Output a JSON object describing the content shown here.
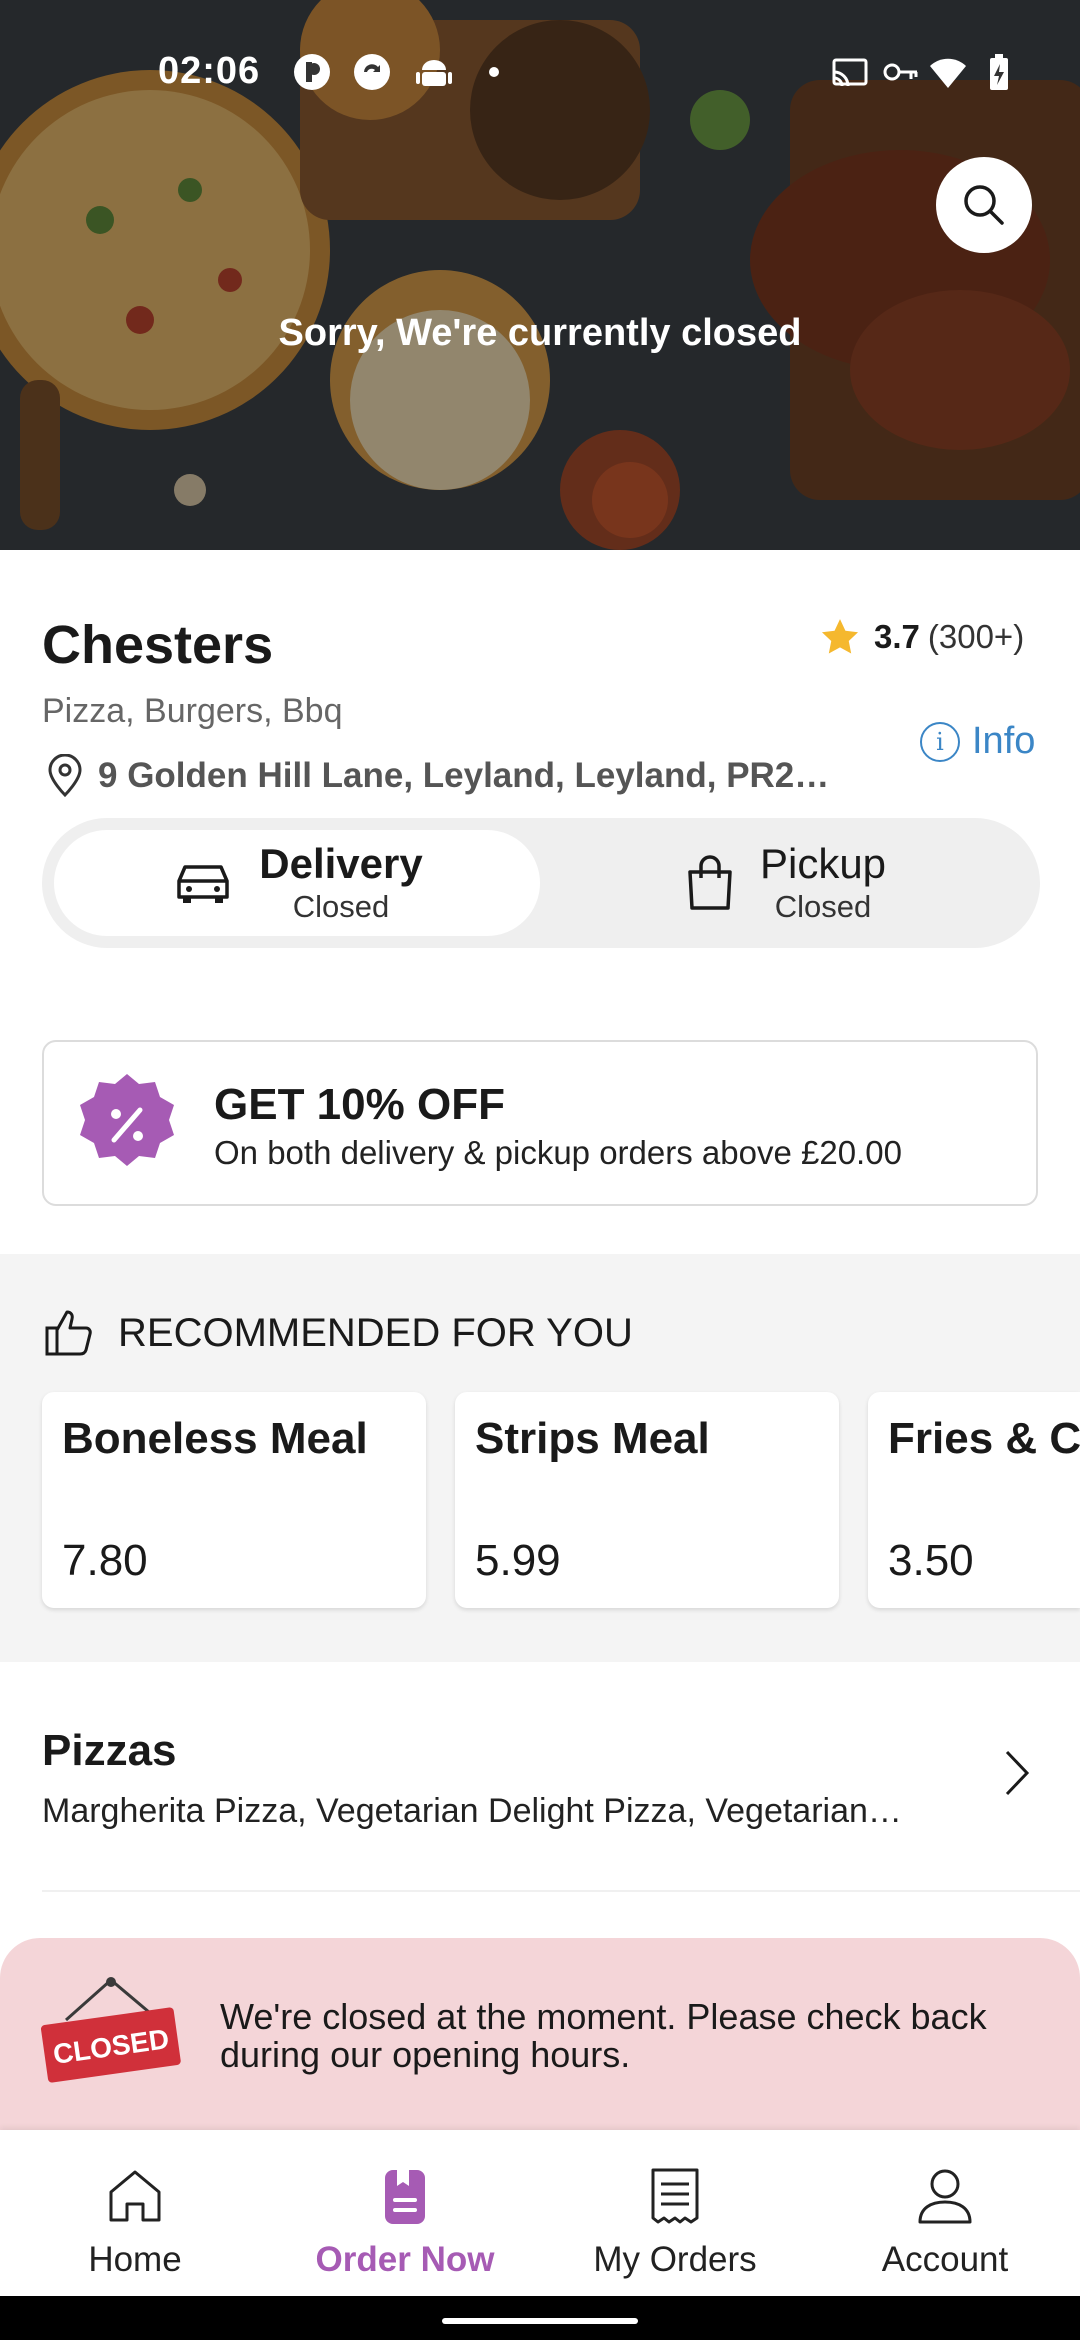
{
  "status_bar": {
    "time": "02:06"
  },
  "hero": {
    "closed_text": "Sorry, We're currently closed"
  },
  "restaurant": {
    "name": "Chesters",
    "rating": "3.7",
    "rating_count": "(300+)",
    "cuisines": "Pizza, Burgers, Bbq",
    "address": "9 Golden Hill Lane, Leyland, Leyland, PR2…",
    "info_label": "Info"
  },
  "modes": [
    {
      "label": "Delivery",
      "status": "Closed",
      "icon": "car-icon",
      "selected": true
    },
    {
      "label": "Pickup",
      "status": "Closed",
      "icon": "shopping-bag-icon",
      "selected": false
    }
  ],
  "promo": {
    "title": "GET 10% OFF",
    "description": "On both delivery & pickup orders above £20.00",
    "icon": "percent-badge-icon"
  },
  "recommended": {
    "heading": "RECOMMENDED FOR YOU",
    "items": [
      {
        "name": "Boneless Meal",
        "price": "7.80"
      },
      {
        "name": "Strips Meal",
        "price": "5.99"
      },
      {
        "name": "Fries & Ch",
        "price": "3.50"
      }
    ]
  },
  "category": {
    "title": "Pizzas",
    "items": "Margherita Pizza, Vegetarian Delight Pizza, Vegetarian…"
  },
  "closed_notice": {
    "sign_text": "CLOSED",
    "line1": "We're closed at the moment. Please check back",
    "line2": "during our opening hours."
  },
  "bottom_nav": [
    {
      "label": "Home",
      "icon": "home-icon"
    },
    {
      "label": "Order Now",
      "icon": "order-icon",
      "active": true
    },
    {
      "label": "My Orders",
      "icon": "receipt-icon"
    },
    {
      "label": "Account",
      "icon": "person-icon"
    }
  ],
  "colors": {
    "accent": "#a65bb4",
    "info_blue": "#3b86c6",
    "star": "#f5b82e",
    "closed_bg": "#f4d5d8",
    "closed_sign": "#d0303a"
  }
}
